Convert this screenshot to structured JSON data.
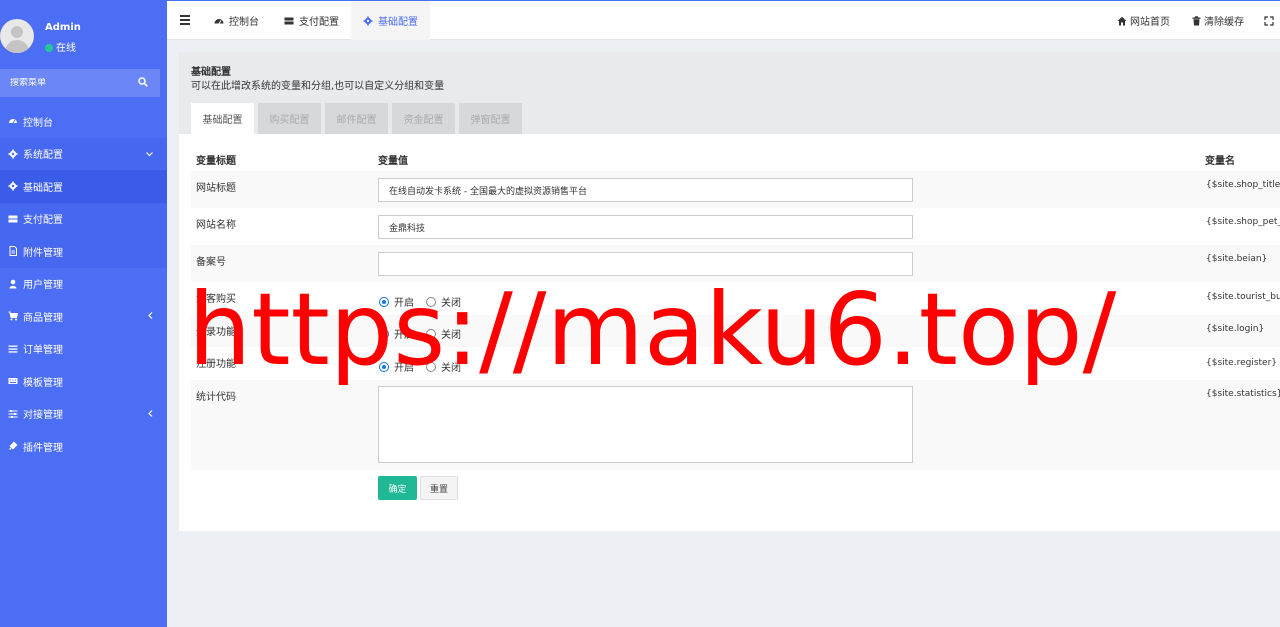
{
  "user": {
    "name": "Admin",
    "status": "在线"
  },
  "search": {
    "placeholder": "搜索菜单"
  },
  "sidebar": {
    "items": [
      {
        "label": "控制台",
        "icon": "dashboard-icon"
      },
      {
        "label": "系统配置",
        "icon": "gear-icon"
      },
      {
        "label": "基础配置",
        "icon": "gear-icon"
      },
      {
        "label": "支付配置",
        "icon": "server-icon"
      },
      {
        "label": "附件管理",
        "icon": "file-icon"
      },
      {
        "label": "用户管理",
        "icon": "user-icon"
      },
      {
        "label": "商品管理",
        "icon": "cart-icon"
      },
      {
        "label": "订单管理",
        "icon": "list-icon"
      },
      {
        "label": "模板管理",
        "icon": "keyboard-icon"
      },
      {
        "label": "对接管理",
        "icon": "sliders-icon"
      },
      {
        "label": "插件管理",
        "icon": "plug-icon"
      }
    ]
  },
  "topnav": {
    "tabs": [
      {
        "label": "控制台"
      },
      {
        "label": "支付配置"
      },
      {
        "label": "基础配置"
      }
    ],
    "home_label": "网站首页",
    "cache_label": "清除缓存"
  },
  "page": {
    "title": "基础配置",
    "desc": "可以在此增改系统的变量和分组,也可以自定义分组和变量",
    "subtabs": [
      "基础配置",
      "购买配置",
      "邮件配置",
      "资金配置",
      "弹窗配置"
    ]
  },
  "table": {
    "headers": {
      "title": "变量标题",
      "value": "变量值",
      "name": "变量名"
    },
    "rows": [
      {
        "label": "网站标题",
        "value": "在线自动发卡系统 - 全国最大的虚拟资源销售平台",
        "var": "{$site.shop_title}"
      },
      {
        "label": "网站名称",
        "value": "金鼎科技",
        "var": "{$site.shop_pet_"
      },
      {
        "label": "备案号",
        "value": "",
        "var": "{$site.beian}"
      },
      {
        "label": "游客购买",
        "on": "开启",
        "off": "关闭",
        "var": "{$site.tourist_buy"
      },
      {
        "label": "登录功能",
        "on": "开启",
        "off": "关闭",
        "var": "{$site.login}"
      },
      {
        "label": "注册功能",
        "on": "开启",
        "off": "关闭",
        "var": "{$site.register}"
      },
      {
        "label": "统计代码",
        "var": "{$site.statistics}"
      }
    ]
  },
  "buttons": {
    "ok": "确定",
    "reset": "重置"
  },
  "watermark": "https://maku6.top/",
  "colors": {
    "sidebar": "#4c6ef5",
    "accent": "#20b897",
    "watermark": "#ff0000"
  }
}
